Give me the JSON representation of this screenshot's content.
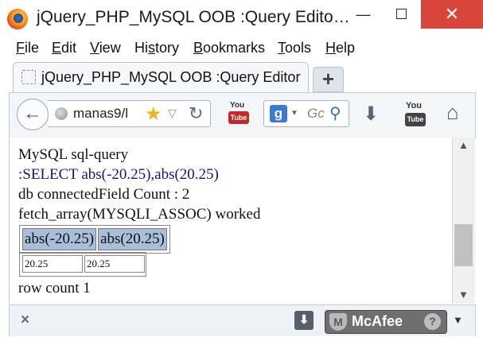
{
  "window": {
    "title": "jQuery_PHP_MySQL OOB :Query Edito…",
    "minimize_glyph": "—",
    "maximize_glyph": "☐",
    "close_glyph": "✕"
  },
  "menu": [
    {
      "underline": "F",
      "rest": "ile"
    },
    {
      "underline": "E",
      "rest": "dit"
    },
    {
      "underline": "V",
      "rest": "iew"
    },
    {
      "pre": "Hi",
      "underline": "s",
      "rest": "tory"
    },
    {
      "underline": "B",
      "rest": "ookmarks"
    },
    {
      "underline": "T",
      "rest": "ools"
    },
    {
      "underline": "H",
      "rest": "elp"
    }
  ],
  "tab": {
    "label": "jQuery_PHP_MySQL OOB :Query Editor",
    "new_tab_glyph": "+"
  },
  "navbar": {
    "url": "manas9/l",
    "search_engine": "g",
    "search_placeholder": "Gc",
    "youtube_small_top": "You",
    "youtube_small_bottom": "Tube",
    "youtube_big_top": "You",
    "youtube_big_bottom": "Tube"
  },
  "content": {
    "line1": "MySQL sql-query",
    "line2": ":SELECT abs(-20.25),abs(20.25)",
    "line3": "db connectedField Count : 2",
    "line4": "fetch_array(MYSQLI_ASSOC) worked",
    "table_headers": [
      "abs(-20.25)",
      "abs(20.25)"
    ],
    "row_values": [
      "20.25",
      "20.25"
    ],
    "line5": "row count 1"
  },
  "addonbar": {
    "close_glyph": "×",
    "mcafee_label": "McAfee",
    "help_glyph": "?"
  },
  "icons": [
    "firefox-logo",
    "back-arrow",
    "globe",
    "star",
    "reload",
    "youtube",
    "google",
    "magnifier",
    "download",
    "home",
    "mcafee-shield"
  ],
  "colors": {
    "close_button": "#d9453a",
    "table_header": "#a8bedb",
    "query_text": "#101588"
  }
}
